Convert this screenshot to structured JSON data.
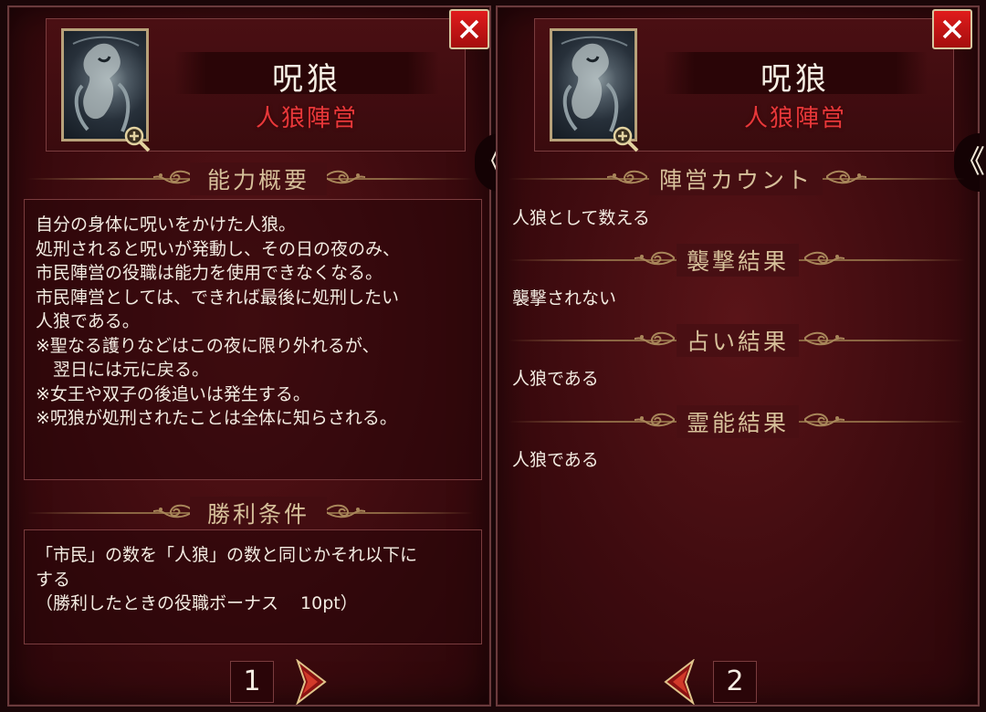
{
  "panel1": {
    "role_name": "呪狼",
    "faction": "人狼陣営",
    "close_icon": "close-icon",
    "side_tab_glyph": "《",
    "ability": {
      "title": "能力概要",
      "lines": [
        "自分の身体に呪いをかけた人狼。",
        "処刑されると呪いが発動し、その日の夜のみ、",
        "市民陣営の役職は能力を使用できなくなる。",
        "市民陣営としては、できれば最後に処刑したい",
        "人狼である。",
        "※聖なる護りなどはこの夜に限り外れるが、",
        "　翌日には元に戻る。",
        "※女王や双子の後追いは発生する。",
        "※呪狼が処刑されたことは全体に知らされる。"
      ]
    },
    "victory": {
      "title": "勝利条件",
      "lines": [
        "「市民」の数を「人狼」の数と同じかそれ以下に",
        "する"
      ],
      "bonus_label": "（勝利したときの役職ボーナス",
      "bonus_value": "10pt）"
    },
    "page_number": "1"
  },
  "panel2": {
    "role_name": "呪狼",
    "faction": "人狼陣営",
    "close_icon": "close-icon",
    "side_tab_glyph": "《",
    "sections": [
      {
        "title": "陣営カウント",
        "value": "人狼として数える"
      },
      {
        "title": "襲撃結果",
        "value": "襲撃されない"
      },
      {
        "title": "占い結果",
        "value": "人狼である"
      },
      {
        "title": "霊能結果",
        "value": "人狼である"
      }
    ],
    "page_number": "2"
  },
  "colors": {
    "panel_bg": "#3e0b0f",
    "faction_red": "#e8383a",
    "section_title": "#d6c09a",
    "close_red": "#e01c1c"
  }
}
